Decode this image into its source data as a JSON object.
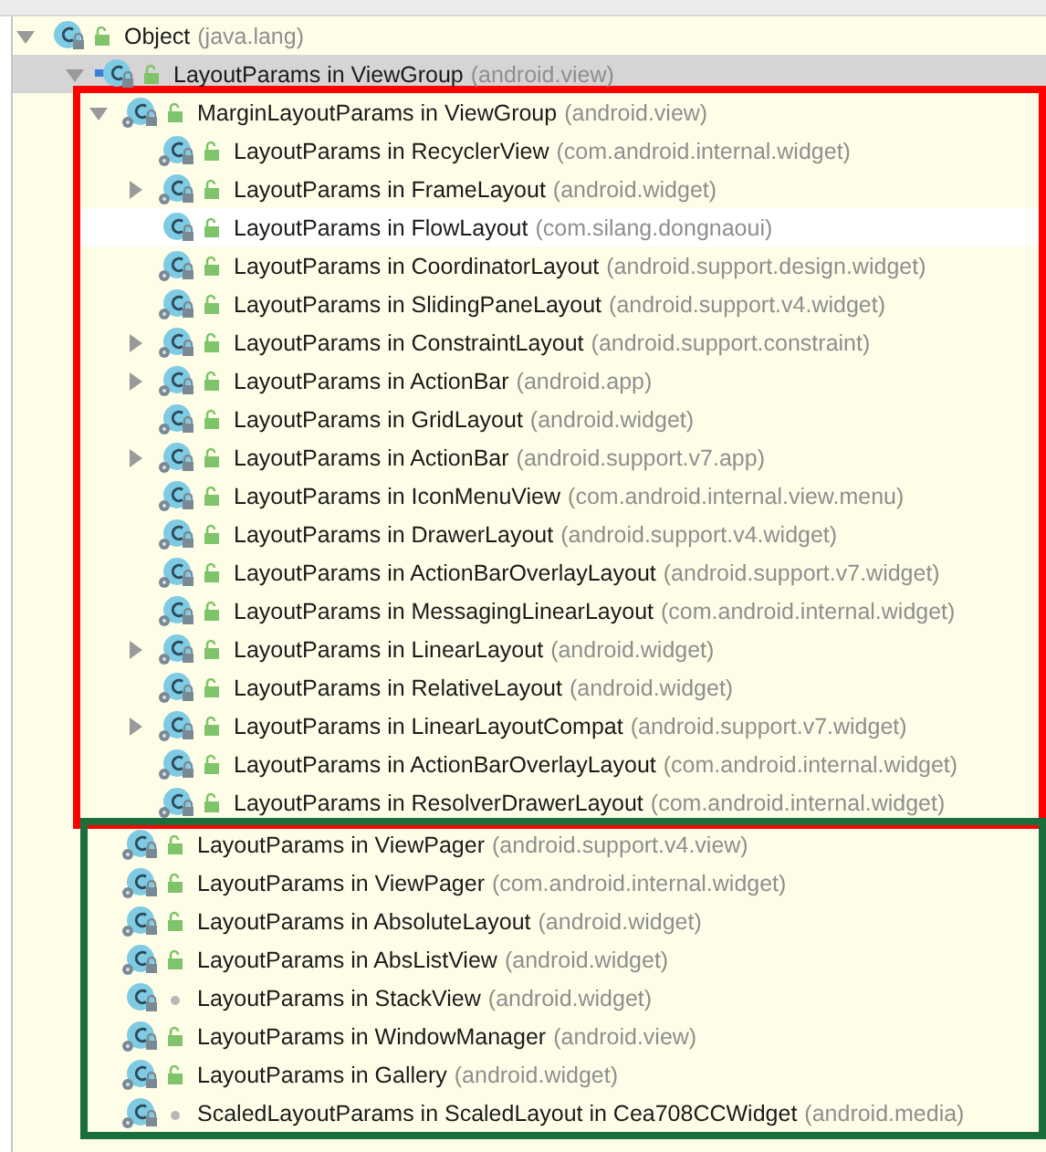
{
  "tree": {
    "name": "Object",
    "package": "(java.lang)",
    "public": true,
    "compiled": false,
    "base": false,
    "selected": false,
    "hovered": false,
    "expanded": true,
    "children": [
      {
        "name": "LayoutParams in ViewGroup",
        "package": "(android.view)",
        "public": true,
        "compiled": false,
        "base": true,
        "selected": true,
        "hovered": false,
        "expanded": true,
        "groups": [
          {
            "color": "#ff0000",
            "children": [
              {
                "name": "MarginLayoutParams in ViewGroup",
                "package": "(android.view)",
                "public": true,
                "compiled": true,
                "base": false,
                "selected": false,
                "hovered": false,
                "expanded": true,
                "children": [
                  {
                    "name": "LayoutParams in RecyclerView",
                    "package": "(com.android.internal.widget)",
                    "public": true,
                    "compiled": true,
                    "base": false,
                    "selected": false,
                    "hovered": false
                  },
                  {
                    "name": "LayoutParams in FrameLayout",
                    "package": "(android.widget)",
                    "public": true,
                    "compiled": true,
                    "base": false,
                    "selected": false,
                    "hovered": false,
                    "expanded": false
                  },
                  {
                    "name": "LayoutParams in FlowLayout",
                    "package": "(com.silang.dongnaoui)",
                    "public": true,
                    "compiled": false,
                    "base": false,
                    "selected": false,
                    "hovered": true
                  },
                  {
                    "name": "LayoutParams in CoordinatorLayout",
                    "package": "(android.support.design.widget)",
                    "public": true,
                    "compiled": true,
                    "base": false,
                    "selected": false,
                    "hovered": false
                  },
                  {
                    "name": "LayoutParams in SlidingPaneLayout",
                    "package": "(android.support.v4.widget)",
                    "public": true,
                    "compiled": true,
                    "base": false,
                    "selected": false,
                    "hovered": false
                  },
                  {
                    "name": "LayoutParams in ConstraintLayout",
                    "package": "(android.support.constraint)",
                    "public": true,
                    "compiled": true,
                    "base": false,
                    "selected": false,
                    "hovered": false,
                    "expanded": false
                  },
                  {
                    "name": "LayoutParams in ActionBar",
                    "package": "(android.app)",
                    "public": true,
                    "compiled": true,
                    "base": false,
                    "selected": false,
                    "hovered": false,
                    "expanded": false
                  },
                  {
                    "name": "LayoutParams in GridLayout",
                    "package": "(android.widget)",
                    "public": true,
                    "compiled": true,
                    "base": false,
                    "selected": false,
                    "hovered": false
                  },
                  {
                    "name": "LayoutParams in ActionBar",
                    "package": "(android.support.v7.app)",
                    "public": true,
                    "compiled": true,
                    "base": false,
                    "selected": false,
                    "hovered": false,
                    "expanded": false
                  },
                  {
                    "name": "LayoutParams in IconMenuView",
                    "package": "(com.android.internal.view.menu)",
                    "public": true,
                    "compiled": true,
                    "base": false,
                    "selected": false,
                    "hovered": false
                  },
                  {
                    "name": "LayoutParams in DrawerLayout",
                    "package": "(android.support.v4.widget)",
                    "public": true,
                    "compiled": true,
                    "base": false,
                    "selected": false,
                    "hovered": false
                  },
                  {
                    "name": "LayoutParams in ActionBarOverlayLayout",
                    "package": "(android.support.v7.widget)",
                    "public": true,
                    "compiled": true,
                    "base": false,
                    "selected": false,
                    "hovered": false
                  },
                  {
                    "name": "LayoutParams in MessagingLinearLayout",
                    "package": "(com.android.internal.widget)",
                    "public": true,
                    "compiled": true,
                    "base": false,
                    "selected": false,
                    "hovered": false
                  },
                  {
                    "name": "LayoutParams in LinearLayout",
                    "package": "(android.widget)",
                    "public": true,
                    "compiled": true,
                    "base": false,
                    "selected": false,
                    "hovered": false,
                    "expanded": false
                  },
                  {
                    "name": "LayoutParams in RelativeLayout",
                    "package": "(android.widget)",
                    "public": true,
                    "compiled": true,
                    "base": false,
                    "selected": false,
                    "hovered": false
                  },
                  {
                    "name": "LayoutParams in LinearLayoutCompat",
                    "package": "(android.support.v7.widget)",
                    "public": true,
                    "compiled": true,
                    "base": false,
                    "selected": false,
                    "hovered": false,
                    "expanded": false
                  },
                  {
                    "name": "LayoutParams in ActionBarOverlayLayout",
                    "package": "(com.android.internal.widget)",
                    "public": true,
                    "compiled": true,
                    "base": false,
                    "selected": false,
                    "hovered": false
                  },
                  {
                    "name": "LayoutParams in ResolverDrawerLayout",
                    "package": "(com.android.internal.widget)",
                    "public": true,
                    "compiled": true,
                    "base": false,
                    "selected": false,
                    "hovered": false
                  }
                ]
              }
            ]
          },
          {
            "color": "#1a6e3c",
            "children": [
              {
                "name": "LayoutParams in ViewPager",
                "package": "(android.support.v4.view)",
                "public": true,
                "compiled": true,
                "base": false,
                "selected": false,
                "hovered": false
              },
              {
                "name": "LayoutParams in ViewPager",
                "package": "(com.android.internal.widget)",
                "public": true,
                "compiled": true,
                "base": false,
                "selected": false,
                "hovered": false
              },
              {
                "name": "LayoutParams in AbsoluteLayout",
                "package": "(android.widget)",
                "public": true,
                "compiled": true,
                "base": false,
                "selected": false,
                "hovered": false
              },
              {
                "name": "LayoutParams in AbsListView",
                "package": "(android.widget)",
                "public": true,
                "compiled": true,
                "base": false,
                "selected": false,
                "hovered": false
              },
              {
                "name": "LayoutParams in StackView",
                "package": "(android.widget)",
                "public": false,
                "compiled": false,
                "base": false,
                "selected": false,
                "hovered": false
              },
              {
                "name": "LayoutParams in WindowManager",
                "package": "(android.view)",
                "public": true,
                "compiled": true,
                "base": false,
                "selected": false,
                "hovered": false
              },
              {
                "name": "LayoutParams in Gallery",
                "package": "(android.widget)",
                "public": true,
                "compiled": true,
                "base": false,
                "selected": false,
                "hovered": false
              },
              {
                "name": "ScaledLayoutParams in ScaledLayout in Cea708CCWidget",
                "package": "(android.media)",
                "public": false,
                "compiled": true,
                "base": false,
                "selected": false,
                "hovered": false
              }
            ]
          }
        ]
      }
    ]
  }
}
